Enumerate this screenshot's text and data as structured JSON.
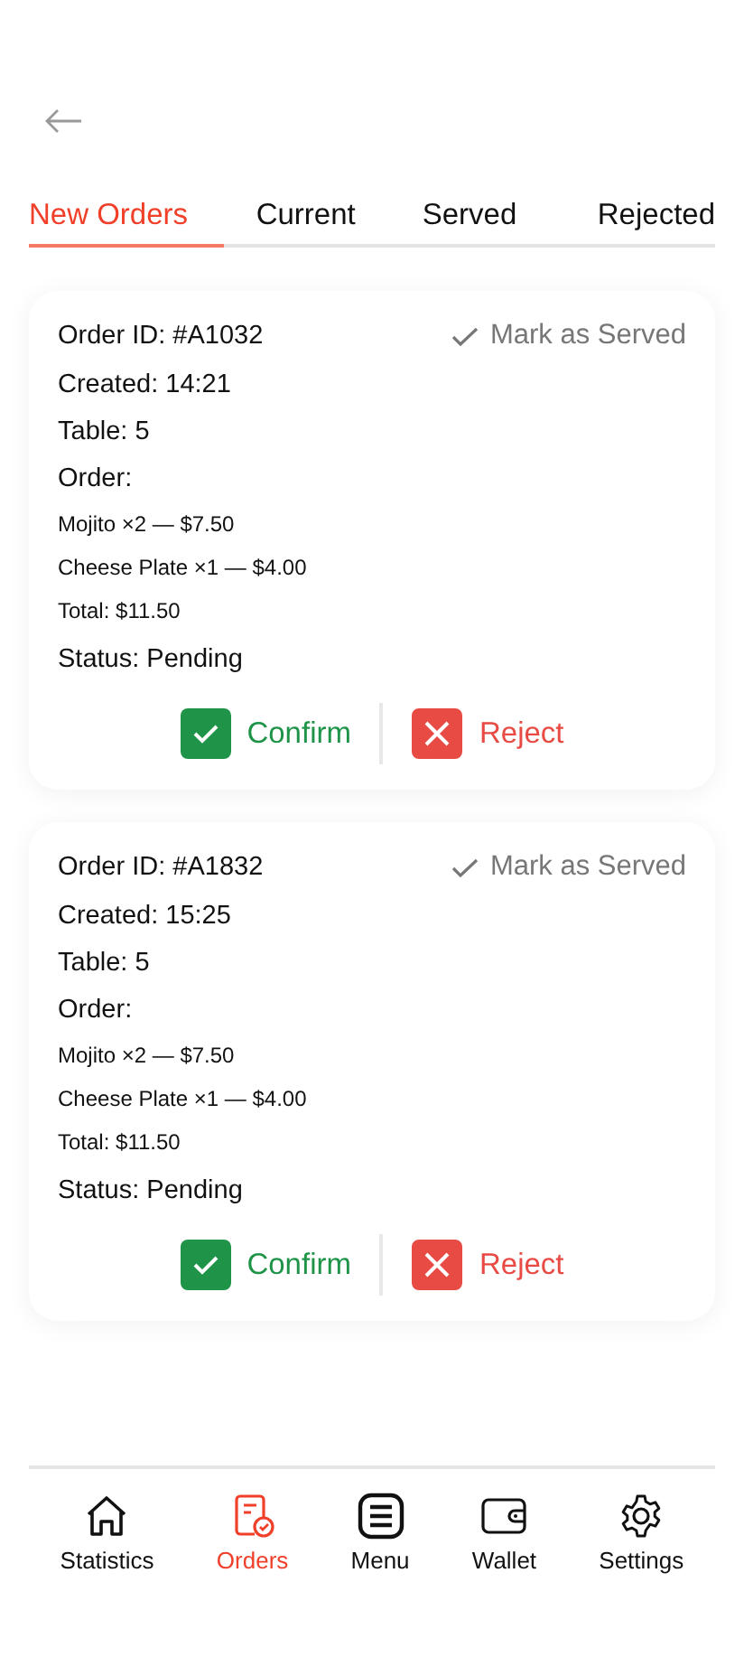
{
  "tabs": [
    {
      "label": "New Orders",
      "selected": true
    },
    {
      "label": "Current",
      "selected": false
    },
    {
      "label": "Served",
      "selected": false
    },
    {
      "label": "Rejected",
      "selected": false
    }
  ],
  "orders": [
    {
      "order_id": "Order ID: #A1032",
      "mark_served": "Mark as Served",
      "created": "Created: 14:21",
      "table": "Table: 5",
      "order_label": "Order:",
      "items": [
        "Mojito ×2 — $7.50",
        "Cheese Plate ×1 — $4.00"
      ],
      "total": "Total: $11.50",
      "status": "Status: Pending",
      "confirm": "Confirm",
      "reject": "Reject"
    },
    {
      "order_id": "Order ID: #A1832",
      "mark_served": "Mark as Served",
      "created": "Created: 15:25",
      "table": "Table: 5",
      "order_label": "Order:",
      "items": [
        "Mojito ×2 — $7.50",
        "Cheese Plate ×1 — $4.00"
      ],
      "total": "Total: $11.50",
      "status": "Status: Pending",
      "confirm": "Confirm",
      "reject": "Reject"
    }
  ],
  "bottom_nav": [
    {
      "label": "Statistics",
      "selected": false
    },
    {
      "label": "Orders",
      "selected": true
    },
    {
      "label": "Menu",
      "selected": false
    },
    {
      "label": "Wallet",
      "selected": false
    },
    {
      "label": "Settings",
      "selected": false
    }
  ]
}
